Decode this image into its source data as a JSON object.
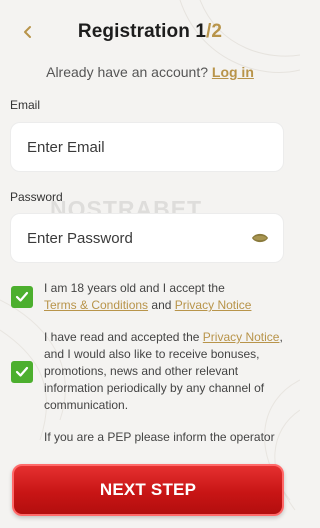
{
  "header": {
    "title": "Registration",
    "step_current": "1",
    "step_separator": "/",
    "step_total": "2"
  },
  "account": {
    "prompt": "Already have an account?",
    "login_label": "Log in"
  },
  "email": {
    "label": "Email",
    "placeholder": "Enter Email"
  },
  "password": {
    "label": "Password",
    "placeholder": "Enter Password"
  },
  "watermark": "NOSTRABET",
  "terms": {
    "checked": true,
    "text_before": "I am 18 years old and I accept the",
    "terms_link": "Terms & Conditions",
    "and": "and",
    "privacy_link": "Privacy Notice"
  },
  "marketing": {
    "checked": true,
    "text_before": "I have read and accepted the",
    "privacy_link": "Privacy Notice",
    "text_after": ", and I would also like to receive bonuses, promotions, news and other relevant information periodically by any channel of communication."
  },
  "pep_notice": "If you are a PEP please inform the operator",
  "next_button": "NEXT STEP",
  "colors": {
    "accent_gold": "#b8944a",
    "checkbox_green": "#4caf2e",
    "button_red": "#d21f1f"
  }
}
